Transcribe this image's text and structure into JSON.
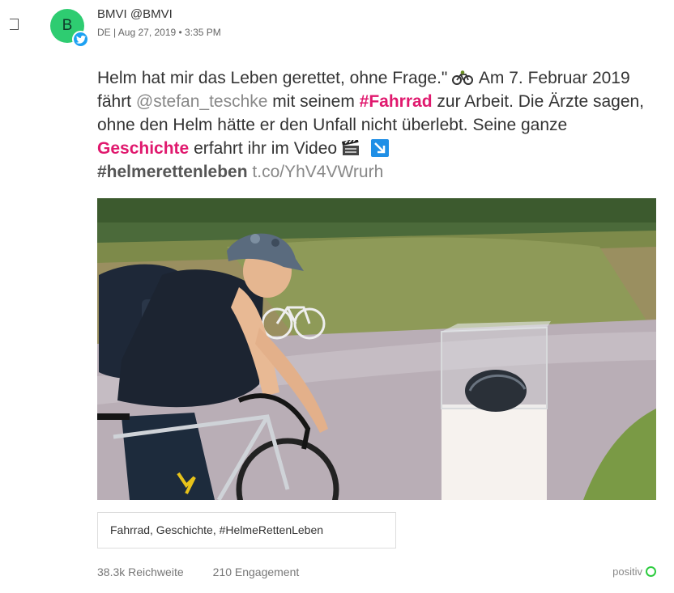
{
  "post": {
    "avatar_letter": "B",
    "author": "BMVI @BMVI",
    "meta": "DE | Aug 27, 2019 • 3:35 PM",
    "text": {
      "t1": "Helm hat mir das Leben gerettet, ohne Frage.\"",
      "t2": "Am 7. Februar 2019 fährt",
      "mention": "@stefan_teschke",
      "t3": "mit seinem",
      "hashtag_fahrrad": "#Fahrrad",
      "t4": "zur Arbeit. Die Ärzte sagen, ohne den Helm hätte er den Unfall nicht überlebt. Seine ganze",
      "geschichte": "Geschichte",
      "t5": "erfahrt ihr im Video",
      "hashtag_helme": "#helmerettenleben",
      "link": "t.co/YhV4VWrurh"
    },
    "tags": "Fahrrad, Geschichte, #HelmeRettenLeben",
    "stats": {
      "reach": "38.3k Reichweite",
      "engagement": "210 Engagement"
    },
    "sentiment": "positiv"
  },
  "colors": {
    "avatar": "#2ecc71",
    "twitter": "#1da1f2",
    "highlight": "#e0196e",
    "positive": "#2ecc40"
  },
  "icons": {
    "selection": "checkbox-icon",
    "network": "twitter-icon",
    "emoji_1": "cyclist-emoji-icon",
    "emoji_2": "clapper-board-emoji-icon",
    "emoji_3": "arrow-down-right-emoji-icon"
  }
}
